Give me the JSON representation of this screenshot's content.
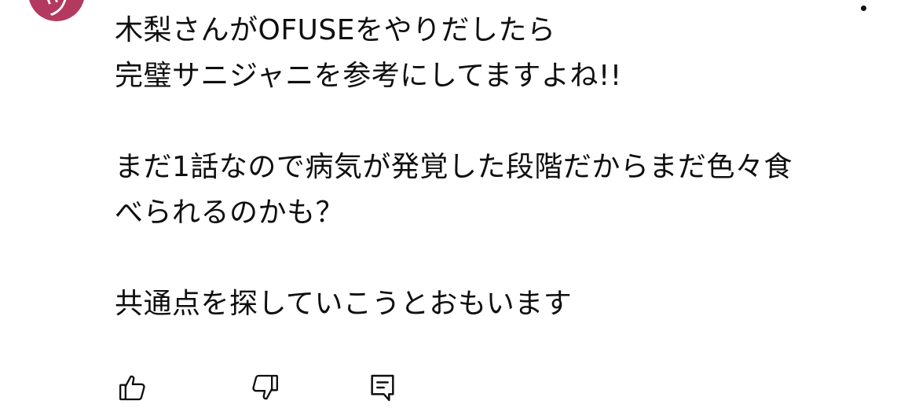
{
  "author": {
    "avatar_initial": "ツ",
    "avatar_color": "#b33a5e"
  },
  "comment": {
    "lines": [
      "木梨さんがOFUSEをやりだしたら",
      "完璧サニジャニを参考にしてますよね!!",
      "",
      "まだ1話なので病気が発覚した段階だからまだ色々食",
      "べられるのかも？",
      "",
      "共通点を探していこうとおもいます"
    ]
  },
  "actions": {
    "like_icon": "thumbs-up-icon",
    "dislike_icon": "thumbs-down-icon",
    "reply_icon": "comment-reply-icon",
    "menu_icon": "more-vert-icon"
  }
}
